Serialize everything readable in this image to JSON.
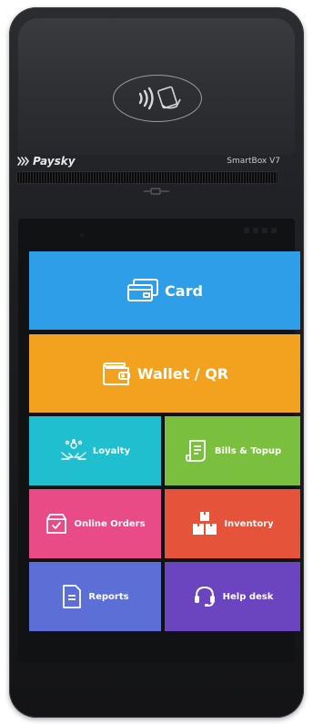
{
  "device": {
    "brand": "Paysky",
    "model": "SmartBox V7"
  },
  "colors": {
    "card": "#2f9ee8",
    "wallet": "#f2a21e",
    "loyalty": "#1fbfd0",
    "bills": "#7bbf3e",
    "orders": "#e84b86",
    "inventory": "#e5533a",
    "reports": "#5b6fd6",
    "help": "#6b45bf"
  },
  "tiles": {
    "card": {
      "label": "Card",
      "icon": "credit-card-icon"
    },
    "wallet": {
      "label": "Wallet / QR",
      "icon": "wallet-icon"
    },
    "loyalty": {
      "label": "Loyalty",
      "icon": "loyalty-icon"
    },
    "bills": {
      "label": "Bills & Topup",
      "icon": "receipt-icon"
    },
    "orders": {
      "label": "Online Orders",
      "icon": "shopping-box-icon"
    },
    "inventory": {
      "label": "Inventory",
      "icon": "boxes-icon"
    },
    "reports": {
      "label": "Reports",
      "icon": "document-icon"
    },
    "help": {
      "label": "Help desk",
      "icon": "headset-icon"
    }
  }
}
